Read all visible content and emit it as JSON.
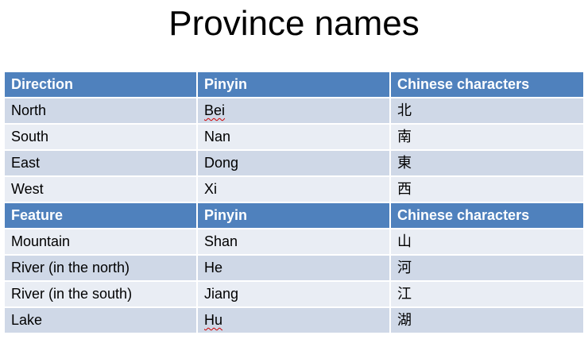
{
  "title": "Province names",
  "direction_section": {
    "headers": [
      "Direction",
      "Pinyin",
      "Chinese characters"
    ],
    "rows": [
      {
        "english": "North",
        "pinyin": "Bei",
        "chinese": "北"
      },
      {
        "english": "South",
        "pinyin": "Nan",
        "chinese": "南"
      },
      {
        "english": "East",
        "pinyin": "Dong",
        "chinese": "東"
      },
      {
        "english": "West",
        "pinyin": "Xi",
        "chinese": "西"
      }
    ]
  },
  "feature_section": {
    "headers": [
      "Feature",
      "Pinyin",
      "Chinese characters"
    ],
    "rows": [
      {
        "english": "Mountain",
        "pinyin": "Shan",
        "chinese": "山"
      },
      {
        "english": "River (in the north)",
        "pinyin": "He",
        "chinese": "河"
      },
      {
        "english": "River (in the south)",
        "pinyin": "Jiang",
        "chinese": "江"
      },
      {
        "english": "Lake",
        "pinyin": "Hu",
        "chinese": "湖"
      }
    ]
  },
  "colors": {
    "header_bg": "#4f81bd",
    "row_dark": "#cfd8e7",
    "row_light": "#e9edf4"
  }
}
